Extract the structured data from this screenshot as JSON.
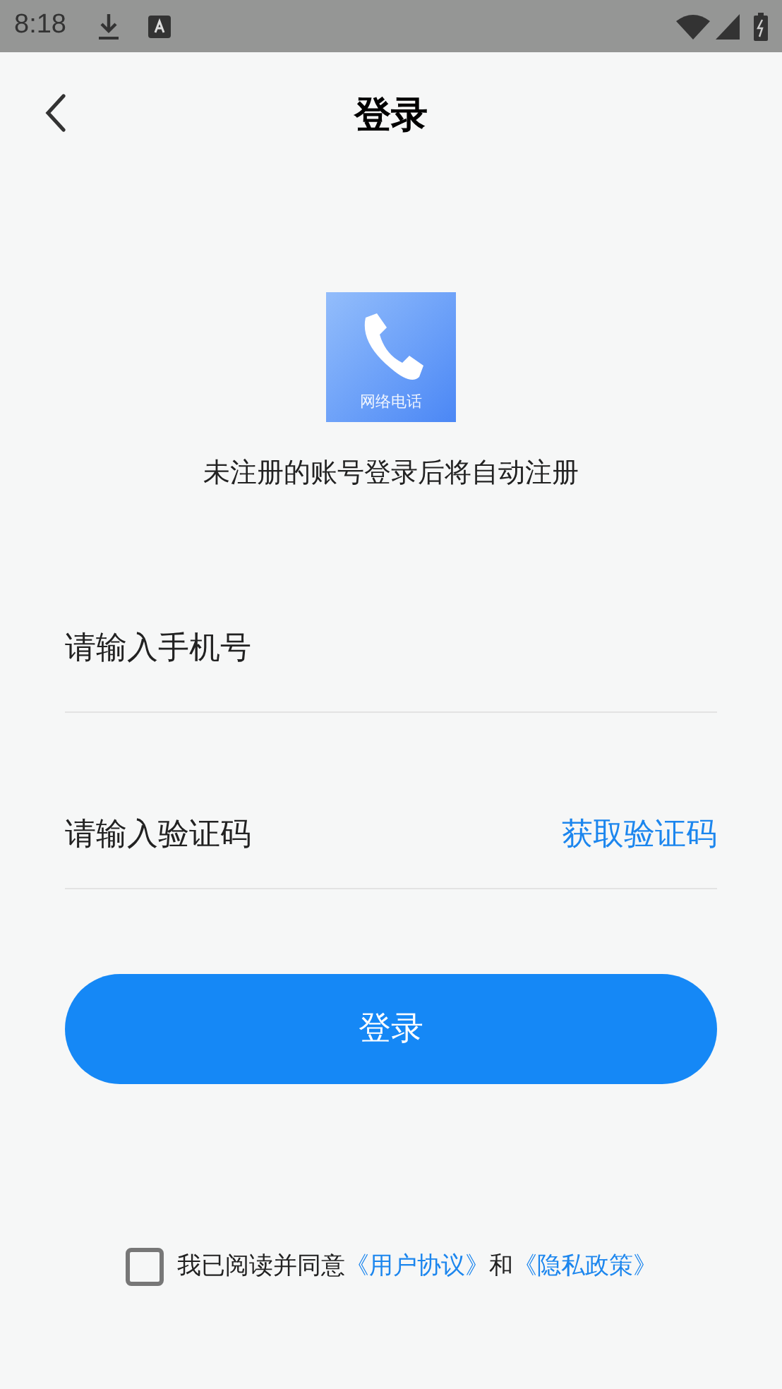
{
  "status_bar": {
    "time": "8:18"
  },
  "header": {
    "title": "登录"
  },
  "logo": {
    "label": "网络电话"
  },
  "hint": "未注册的账号登录后将自动注册",
  "phone_field": {
    "placeholder": "请输入手机号"
  },
  "code_field": {
    "placeholder": "请输入验证码"
  },
  "get_code_button": "获取验证码",
  "login_button": "登录",
  "agreement": {
    "checked": false,
    "parts": [
      {
        "kind": "text",
        "text": "我已阅读并同意"
      },
      {
        "kind": "link",
        "text": "《用户协议》"
      },
      {
        "kind": "text",
        "text": "和"
      },
      {
        "kind": "link",
        "text": "《隐私政策》"
      }
    ]
  }
}
